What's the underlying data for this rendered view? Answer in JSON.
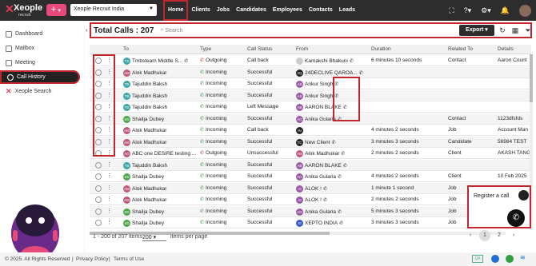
{
  "header": {
    "logo_text": "Xeople",
    "logo_sub": "recruit",
    "add_label": "+",
    "org_select": "Xeople Recruit India",
    "nav": [
      "Home",
      "Clients",
      "Jobs",
      "Candidates",
      "Employees",
      "Contacts",
      "Leads"
    ]
  },
  "sidebar": {
    "items": [
      {
        "label": "Dashboard",
        "icon": "dashboard-icon"
      },
      {
        "label": "Mailbox",
        "icon": "mailbox-icon"
      },
      {
        "label": "Meeting",
        "icon": "meeting-icon"
      },
      {
        "label": "Call History",
        "icon": "call-history-icon"
      },
      {
        "label": "Xeople Search",
        "icon": "xeople-icon"
      }
    ]
  },
  "toolbar": {
    "title": "Total Calls : 207",
    "search_placeholder": "Search",
    "export_label": "Export"
  },
  "table": {
    "columns": [
      "To",
      "Type",
      "Call Status",
      "From",
      "Duration",
      "Related To",
      "Details"
    ],
    "rows": [
      {
        "to": "Tmbsteam Middle S...",
        "to_init": "TS",
        "to_color": "#3aa6a6",
        "type": "Outgoing",
        "status": "Call back",
        "from": "Kamakshi Bhakuni",
        "from_init": "",
        "from_color": "#888",
        "duration": "6 minutes 10 seconds",
        "related": "Contact",
        "details": "Aaron Count"
      },
      {
        "to": "Alok Madhukar",
        "to_init": "AM",
        "to_color": "#c0587a",
        "type": "Incoming",
        "status": "Successful",
        "from": "24DECLIVE QAROA...",
        "from_init": "2Q",
        "from_color": "#222",
        "duration": "",
        "related": "",
        "details": ""
      },
      {
        "to": "Tajuddin Baksh",
        "to_init": "TB",
        "to_color": "#3aa6a6",
        "type": "Incoming",
        "status": "Successful",
        "from": "Ankur Singh",
        "from_init": "AS",
        "from_color": "#9a5aa6",
        "duration": "",
        "related": "",
        "details": ""
      },
      {
        "to": "Tajuddin Baksh",
        "to_init": "TB",
        "to_color": "#3aa6a6",
        "type": "Incoming",
        "status": "Successful",
        "from": "Ankur Singh",
        "from_init": "AS",
        "from_color": "#9a5aa6",
        "duration": "",
        "related": "",
        "details": ""
      },
      {
        "to": "Tajuddin Baksh",
        "to_init": "TB",
        "to_color": "#3aa6a6",
        "type": "Incoming",
        "status": "Left Message",
        "from": "AARON BLAKE",
        "from_init": "AB",
        "from_color": "#9a5aa6",
        "duration": "",
        "related": "",
        "details": ""
      },
      {
        "to": "Shailja Dubey",
        "to_init": "SD",
        "to_color": "#4aa64a",
        "type": "Incoming",
        "status": "Successful",
        "from": "Anika Gularia",
        "from_init": "AG",
        "from_color": "#9a5aa6",
        "duration": "",
        "related": "Contact",
        "details": "1123dfsfds"
      },
      {
        "to": "Alok Madhukar",
        "to_init": "AM",
        "to_color": "#c0587a",
        "type": "Incoming",
        "status": "Call back",
        "from": "",
        "from_init": "IN",
        "from_color": "#222",
        "duration": "4 minutes 2 seconds",
        "related": "Job",
        "details": "Account Man"
      },
      {
        "to": "Alok Madhukar",
        "to_init": "AM",
        "to_color": "#c0587a",
        "type": "Incoming",
        "status": "Successful",
        "from": "New Client",
        "from_init": "TC",
        "from_color": "#222",
        "duration": "3 minutes 3 seconds",
        "related": "Candidate",
        "details": "56984 TEST"
      },
      {
        "to": "ABC one DESIRE testing ...",
        "to_init": "AO",
        "to_color": "#c0587a",
        "type": "Outgoing",
        "status": "Unsuccessful",
        "from": "Alok Madhukar",
        "from_init": "AM",
        "from_color": "#c0587a",
        "duration": "2 minutes 2 seconds",
        "related": "Client",
        "details": "AKASH TANG"
      },
      {
        "to": "Tajuddin Baksh",
        "to_init": "TB",
        "to_color": "#3aa6a6",
        "type": "Incoming",
        "status": "Successful",
        "from": "AARON BLAKE",
        "from_init": "AB",
        "from_color": "#9a5aa6",
        "duration": "",
        "related": "",
        "details": ""
      },
      {
        "to": "Shailja Dubey",
        "to_init": "SD",
        "to_color": "#4aa64a",
        "type": "Incoming",
        "status": "Successful",
        "from": "Anika Gularia",
        "from_init": "AG",
        "from_color": "#9a5aa6",
        "duration": "4 minutes 2 seconds",
        "related": "Client",
        "details": "10 Feb 2025"
      },
      {
        "to": "Alok Madhukar",
        "to_init": "AM",
        "to_color": "#c0587a",
        "type": "Incoming",
        "status": "Successful",
        "from": "ALOK !",
        "from_init": "AI",
        "from_color": "#9a5aa6",
        "duration": "1 minute 1 second",
        "related": "Job",
        "details": ""
      },
      {
        "to": "Alok Madhukar",
        "to_init": "AM",
        "to_color": "#c0587a",
        "type": "Incoming",
        "status": "Successful",
        "from": "ALOK !",
        "from_init": "AI",
        "from_color": "#9a5aa6",
        "duration": "2 minutes 2 seconds",
        "related": "Job",
        "details": ""
      },
      {
        "to": "Shailja Dubey",
        "to_init": "SD",
        "to_color": "#4aa64a",
        "type": "Incoming",
        "status": "Successful",
        "from": "Anika Gularia",
        "from_init": "AG",
        "from_color": "#9a5aa6",
        "duration": "5 minutes 3 seconds",
        "related": "Job",
        "details": ""
      },
      {
        "to": "Shailja Dubey",
        "to_init": "SD",
        "to_color": "#4aa64a",
        "type": "Incoming",
        "status": "Successful",
        "from": "XEPTO INDIA",
        "from_init": "XI",
        "from_color": "#3a5ad0",
        "duration": "3 minutes 3 seconds",
        "related": "Job",
        "details": ""
      }
    ]
  },
  "pager": {
    "range": "1 - 200 of 207 items",
    "per_page": "200",
    "per_page_label": "items per page",
    "pages": [
      "1",
      "2"
    ]
  },
  "register": {
    "label": "Register a call"
  },
  "footer": {
    "copyright": "© 2025. All Rights Reserved",
    "privacy": "Privacy Policy",
    "terms": "Terms of Use",
    "qa": "QA"
  }
}
